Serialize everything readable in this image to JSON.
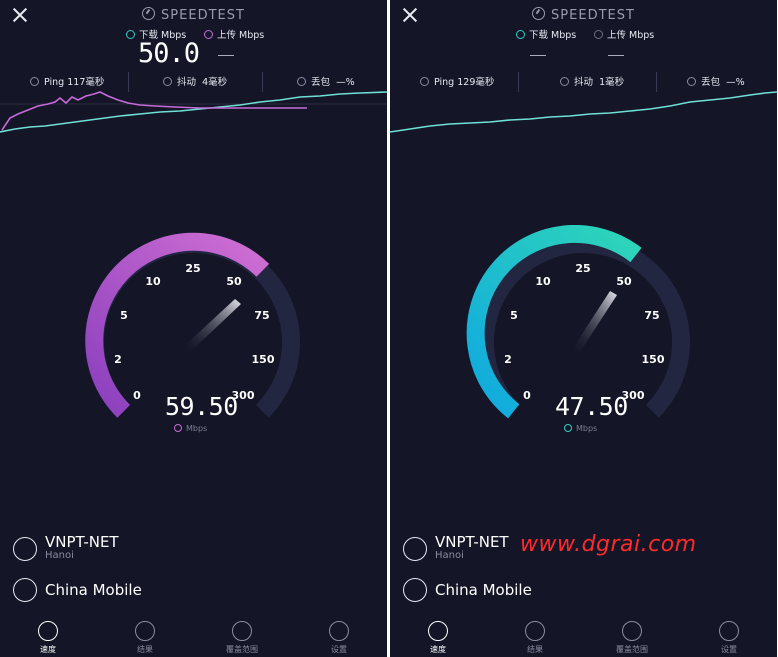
{
  "app": {
    "title": "SPEEDTEST"
  },
  "labels": {
    "download": "下载 Mbps",
    "upload": "上传 Mbps",
    "ping": "Ping",
    "jitter": "抖动",
    "loss": "丢包",
    "unit": "Mbps"
  },
  "left": {
    "download_value": "50.0",
    "upload_value": "—",
    "ping": "117毫秒",
    "jitter": "4毫秒",
    "loss": "—%",
    "reading": "59.50",
    "mode": "upload",
    "accent": "#c66bd8",
    "gauge_value_mbps": 59.5
  },
  "right": {
    "download_value": "—",
    "upload_value": "—",
    "ping": "129毫秒",
    "jitter": "1毫秒",
    "loss": "—%",
    "reading": "47.50",
    "mode": "download",
    "accent": "#2fd0c2",
    "gauge_value_mbps": 47.5
  },
  "gauge_ticks": [
    "0",
    "2",
    "5",
    "10",
    "25",
    "50",
    "75",
    "150",
    "300"
  ],
  "provider": {
    "name": "VNPT-NET",
    "location": "Hanoi",
    "carrier": "China Mobile"
  },
  "tabs": [
    {
      "label": "速度",
      "icon": "speedometer-icon"
    },
    {
      "label": "结果",
      "icon": "check-circle-icon"
    },
    {
      "label": "覆盖范围",
      "icon": "map-pin-icon"
    },
    {
      "label": "设置",
      "icon": "gear-icon"
    }
  ],
  "watermark": "www.dgrai.com",
  "colors": {
    "background": "#141526",
    "download_accent": "#2fd0c2",
    "upload_accent": "#c66bd8",
    "gauge_track": "#232641"
  }
}
